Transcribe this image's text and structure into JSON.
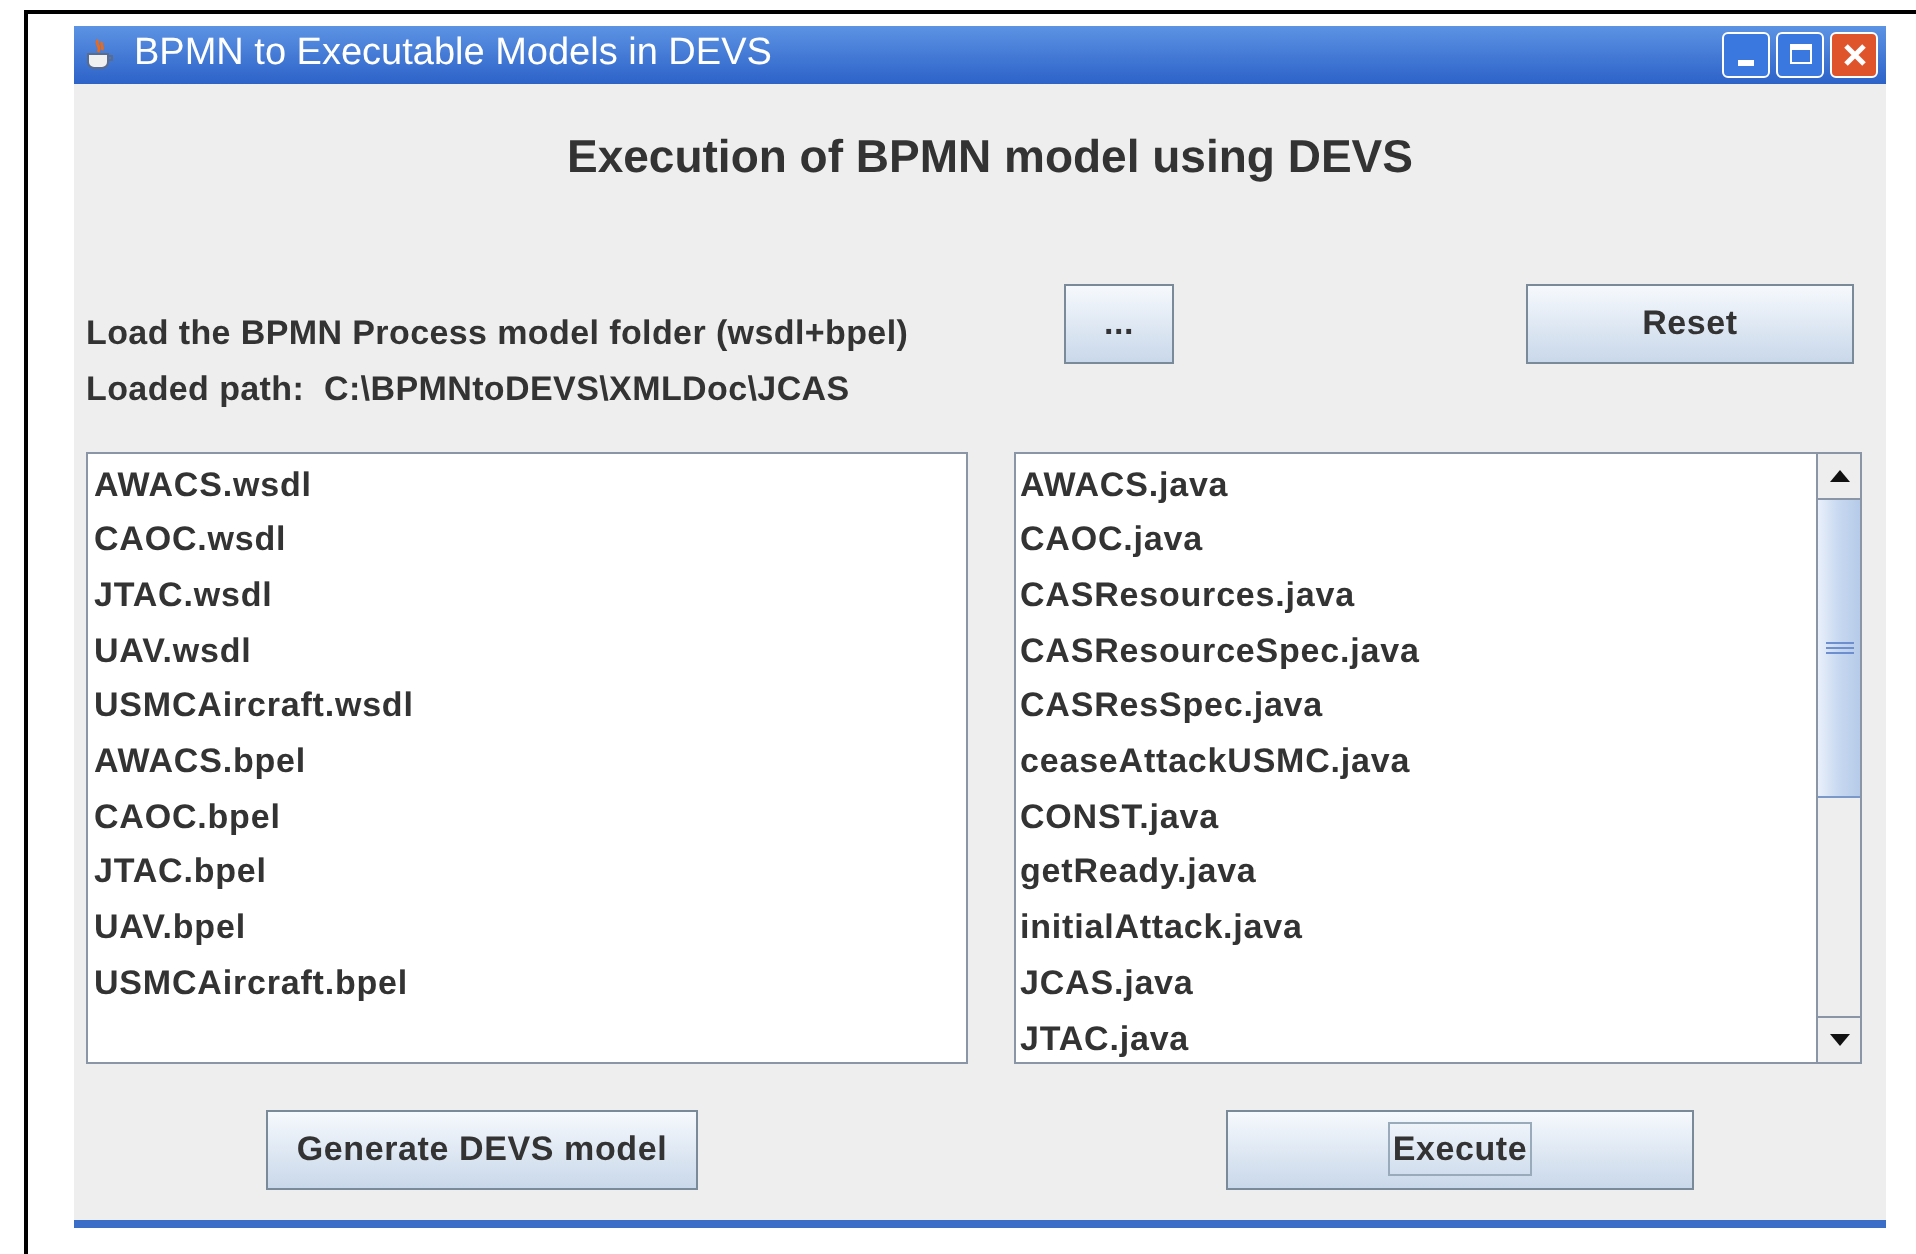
{
  "window": {
    "title": "BPMN to Executable Models in DEVS"
  },
  "heading": "Execution of BPMN model using DEVS",
  "load_label": "Load the BPMN Process model folder (wsdl+bpel)",
  "loaded_path": "Loaded path:  C:\\BPMNtoDEVS\\XMLDoc\\JCAS",
  "browse_button": {
    "label": "...",
    "focused": false
  },
  "reset_button": {
    "label": "Reset",
    "focused": false
  },
  "source_files": [
    "AWACS.wsdl",
    "CAOC.wsdl",
    "JTAC.wsdl",
    "UAV.wsdl",
    "USMCAircraft.wsdl",
    "AWACS.bpel",
    "CAOC.bpel",
    "JTAC.bpel",
    "UAV.bpel",
    "USMCAircraft.bpel"
  ],
  "java_files": [
    "AWACS.java",
    "CAOC.java",
    "CASResources.java",
    "CASResourceSpec.java",
    "CASResSpec.java",
    "ceaseAttackUSMC.java",
    "CONST.java",
    "getReady.java",
    "initialAttack.java",
    "JCAS.java",
    "JTAC.java"
  ],
  "generate_button": {
    "label": "Generate DEVS model",
    "focused": false
  },
  "execute_button": {
    "label": "Execute",
    "focused": true
  }
}
